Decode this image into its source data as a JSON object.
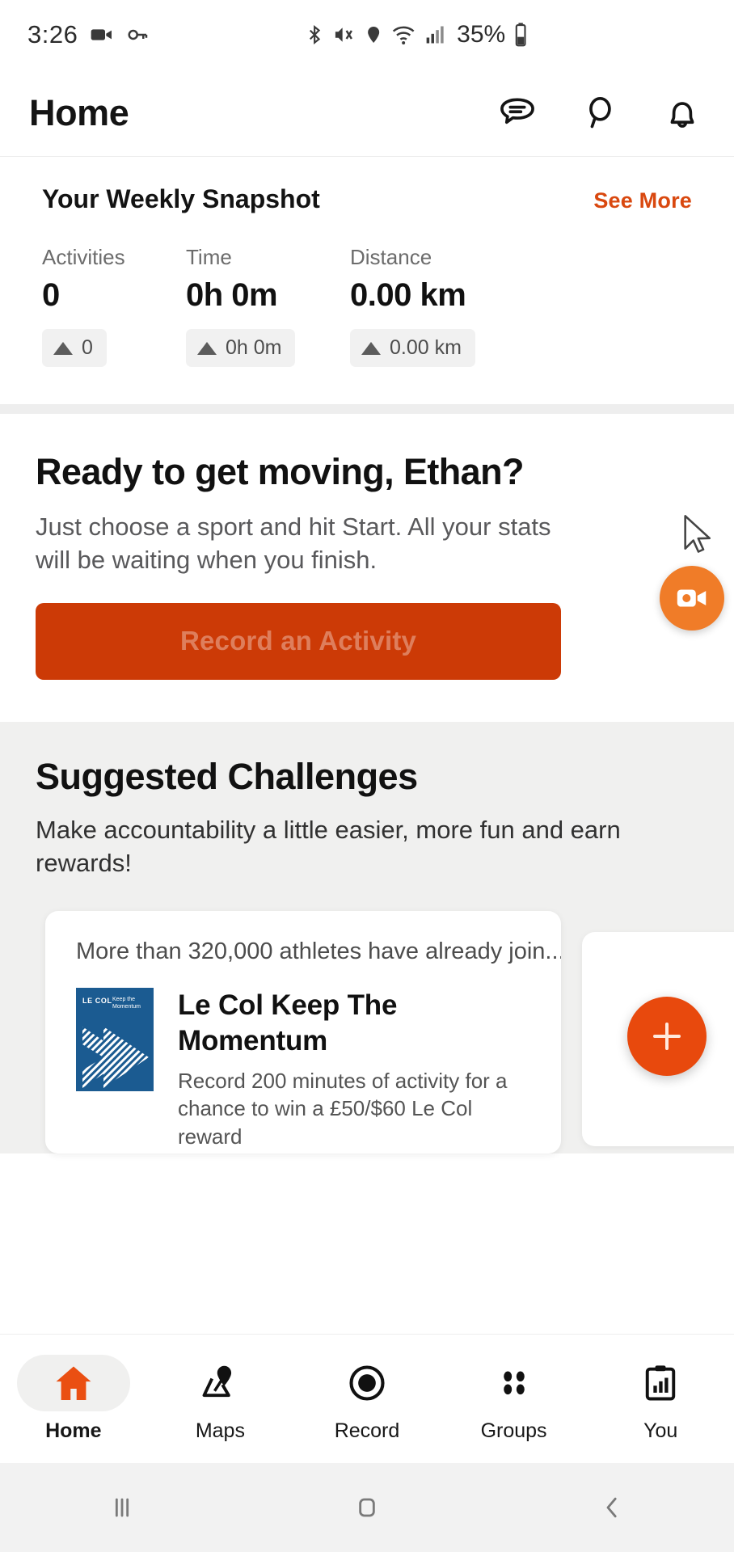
{
  "statusbar": {
    "time": "3:26",
    "battery_pct": "35%",
    "icons": [
      "video-camera-icon",
      "key-icon",
      "bluetooth-icon",
      "mute-vibrate-icon",
      "location-icon",
      "wifi-icon",
      "cellular-signal-icon",
      "battery-icon"
    ]
  },
  "header": {
    "title": "Home",
    "icons": [
      "chat-icon",
      "search-icon",
      "bell-icon"
    ]
  },
  "snapshot": {
    "title": "Your Weekly Snapshot",
    "see_more": "See More",
    "stats": [
      {
        "label": "Activities",
        "value": "0",
        "badge": "0"
      },
      {
        "label": "Time",
        "value": "0h 0m",
        "badge": "0h 0m"
      },
      {
        "label": "Distance",
        "value": "0.00 km",
        "badge": "0.00 km"
      }
    ]
  },
  "ready": {
    "heading": "Ready to get moving, Ethan?",
    "body": "Just choose a sport and hit Start. All your stats will be waiting when you finish.",
    "cta_label": "Record an Activity"
  },
  "challenges": {
    "heading": "Suggested Challenges",
    "subtitle": "Make accountability a little easier, more fun and earn rewards!",
    "card": {
      "lead": "More than 320,000 athletes have already join...",
      "logo_brand": "LE COL",
      "logo_tagline": "Keep the Momentum",
      "title": "Le Col Keep The Momentum",
      "description": "Record 200 minutes of activity for a chance to win a £50/$60 Le Col reward"
    }
  },
  "bottom_nav": {
    "items": [
      {
        "label": "Home",
        "icon": "home-icon",
        "active": true
      },
      {
        "label": "Maps",
        "icon": "map-pin-icon",
        "active": false
      },
      {
        "label": "Record",
        "icon": "record-circle-icon",
        "active": false
      },
      {
        "label": "Groups",
        "icon": "groups-dots-icon",
        "active": false
      },
      {
        "label": "You",
        "icon": "clipboard-chart-icon",
        "active": false
      }
    ]
  },
  "system_nav": {
    "recents": "recents-icon",
    "home": "home-square-icon",
    "back": "back-chevron-icon"
  },
  "colors": {
    "brand_orange": "#cc3a06",
    "accent_orange": "#e8490d",
    "fab_orange": "#f07c28",
    "link_orange": "#d9480f",
    "logo_blue": "#1b5b91"
  }
}
